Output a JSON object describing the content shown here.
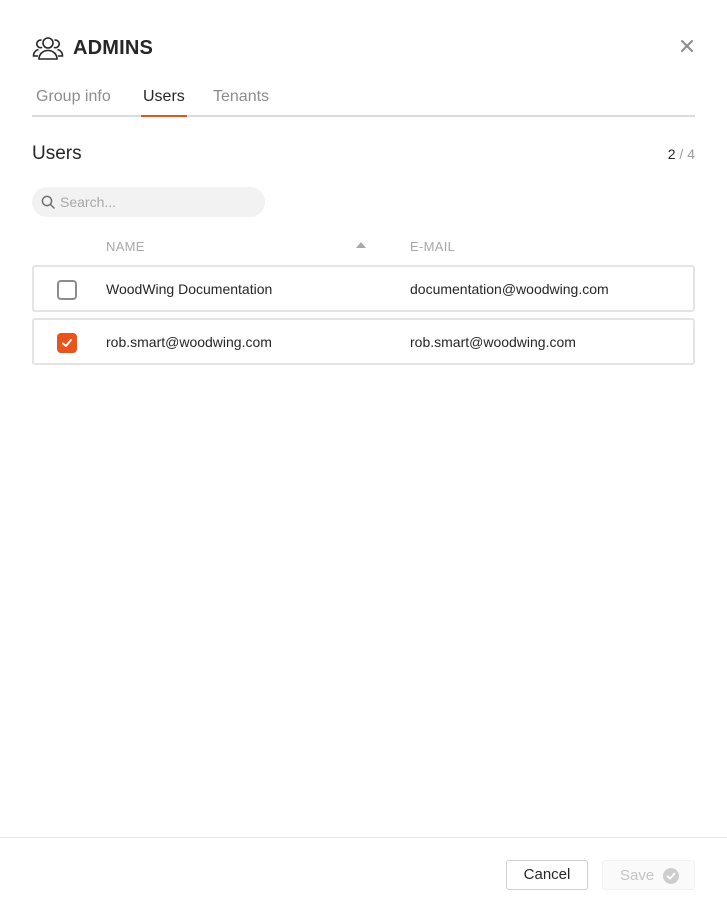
{
  "dialog": {
    "title": "ADMINS",
    "icon": "users-group-icon"
  },
  "tabs": [
    {
      "label": "Group info",
      "active": false
    },
    {
      "label": "Users",
      "active": true
    },
    {
      "label": "Tenants",
      "active": false
    }
  ],
  "users_section": {
    "title": "Users",
    "selected_count": "2",
    "separator": "/",
    "total_count": "4"
  },
  "search": {
    "placeholder": "Search...",
    "value": ""
  },
  "table": {
    "columns": {
      "name": "NAME",
      "email": "E-MAIL"
    },
    "sort": {
      "column": "name",
      "direction": "ascending"
    },
    "rows": [
      {
        "name": "WoodWing Documentation",
        "email": "documentation@woodwing.com",
        "checked": false
      },
      {
        "name": "rob.smart@woodwing.com",
        "email": "rob.smart@woodwing.com",
        "checked": true
      }
    ]
  },
  "footer": {
    "cancel_label": "Cancel",
    "save_label": "Save",
    "save_enabled": false
  },
  "colors": {
    "accent": "#e8541c",
    "text": "#262626",
    "muted": "#a8a8a8"
  }
}
